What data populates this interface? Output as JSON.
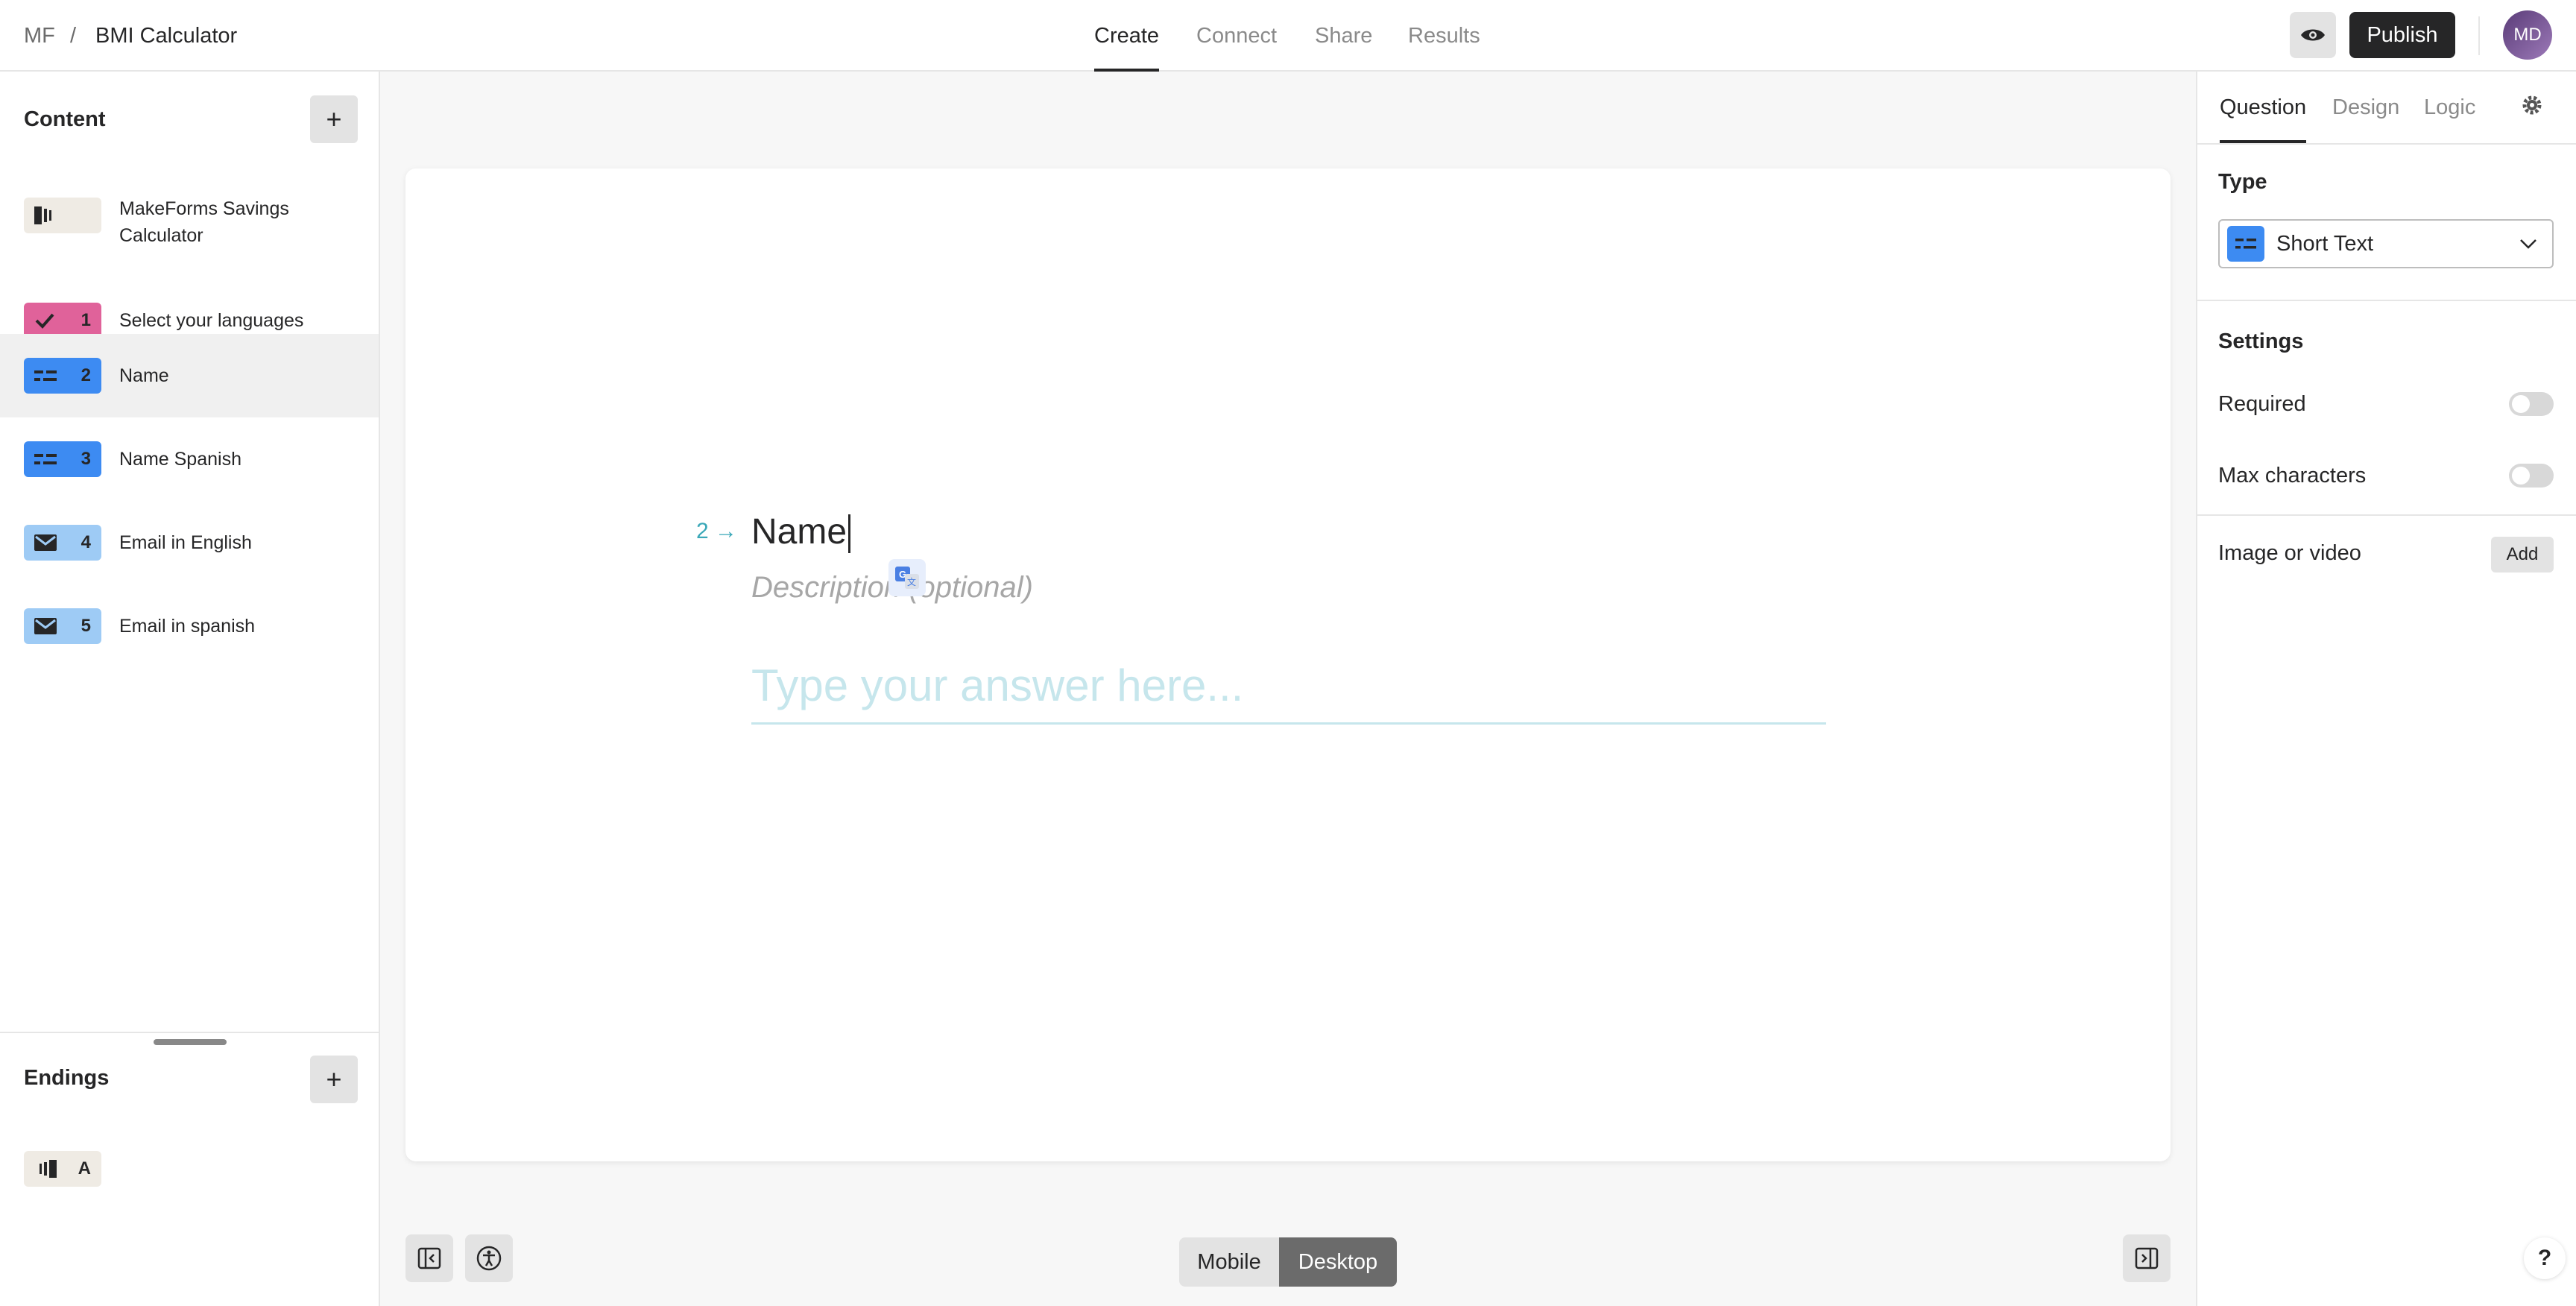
{
  "breadcrumb": {
    "workspace": "MF",
    "separator": "/",
    "form_title": "BMI Calculator"
  },
  "nav": {
    "tabs": [
      {
        "label": "Create"
      },
      {
        "label": "Connect"
      },
      {
        "label": "Share"
      },
      {
        "label": "Results"
      }
    ],
    "active": "Create"
  },
  "header": {
    "publish_label": "Publish",
    "avatar_initials": "MD",
    "preview_icon": "eye-icon"
  },
  "sidebar": {
    "content_title": "Content",
    "add_icon": "plus-icon",
    "items": [
      {
        "number": "",
        "label": "MakeForms Savings Calculator",
        "icon": "welcome-screen-icon",
        "color": "#efebe4"
      },
      {
        "number": "1",
        "label": "Select your languages",
        "icon": "checkmark-icon",
        "color": "#e0629a"
      },
      {
        "number": "2",
        "label": "Name",
        "icon": "short-text-icon",
        "color": "#3d8bf2",
        "selected": true
      },
      {
        "number": "3",
        "label": "Name Spanish",
        "icon": "short-text-icon",
        "color": "#3d8bf2"
      },
      {
        "number": "4",
        "label": "Email in English",
        "icon": "email-icon",
        "color": "#9ecbf5"
      },
      {
        "number": "5",
        "label": "Email in spanish",
        "icon": "email-icon",
        "color": "#9ecbf5"
      }
    ],
    "endings_title": "Endings",
    "endings": [
      {
        "number": "A",
        "icon": "ending-screen-icon",
        "color": "#efebe4"
      }
    ]
  },
  "question": {
    "number": "2",
    "arrow": "→",
    "title": "Name",
    "description_placeholder": "Description (optional)",
    "answer_placeholder": "Type your answer here..."
  },
  "bottom_bar": {
    "mobile_label": "Mobile",
    "desktop_label": "Desktop",
    "active_device": "Desktop"
  },
  "right_panel": {
    "tabs": [
      {
        "label": "Question"
      },
      {
        "label": "Design"
      },
      {
        "label": "Logic"
      }
    ],
    "active_tab": "Question",
    "type_heading": "Type",
    "type_value": "Short Text",
    "settings_heading": "Settings",
    "required_label": "Required",
    "required_on": false,
    "max_chars_label": "Max characters",
    "max_chars_on": false,
    "media_label": "Image or video",
    "media_add_label": "Add"
  },
  "help": {
    "label": "?"
  },
  "colors": {
    "accent_teal": "#3aa8b8",
    "short_text_blue": "#3d8bf2",
    "choice_pink": "#e0629a",
    "email_light_blue": "#9ecbf5",
    "dark": "#262627"
  }
}
